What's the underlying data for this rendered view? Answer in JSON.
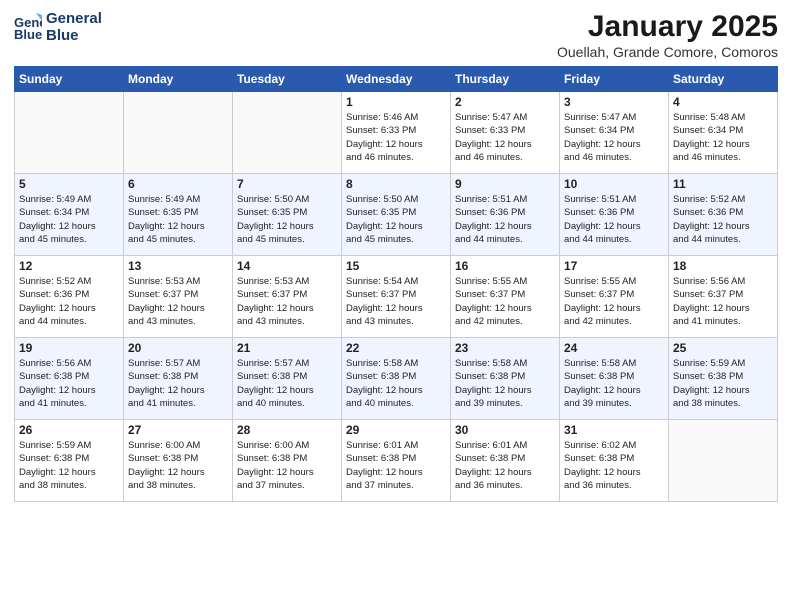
{
  "logo": {
    "line1": "General",
    "line2": "Blue"
  },
  "title": "January 2025",
  "subtitle": "Ouellah, Grande Comore, Comoros",
  "weekdays": [
    "Sunday",
    "Monday",
    "Tuesday",
    "Wednesday",
    "Thursday",
    "Friday",
    "Saturday"
  ],
  "weeks": [
    [
      {
        "day": "",
        "info": ""
      },
      {
        "day": "",
        "info": ""
      },
      {
        "day": "",
        "info": ""
      },
      {
        "day": "1",
        "info": "Sunrise: 5:46 AM\nSunset: 6:33 PM\nDaylight: 12 hours\nand 46 minutes."
      },
      {
        "day": "2",
        "info": "Sunrise: 5:47 AM\nSunset: 6:33 PM\nDaylight: 12 hours\nand 46 minutes."
      },
      {
        "day": "3",
        "info": "Sunrise: 5:47 AM\nSunset: 6:34 PM\nDaylight: 12 hours\nand 46 minutes."
      },
      {
        "day": "4",
        "info": "Sunrise: 5:48 AM\nSunset: 6:34 PM\nDaylight: 12 hours\nand 46 minutes."
      }
    ],
    [
      {
        "day": "5",
        "info": "Sunrise: 5:49 AM\nSunset: 6:34 PM\nDaylight: 12 hours\nand 45 minutes."
      },
      {
        "day": "6",
        "info": "Sunrise: 5:49 AM\nSunset: 6:35 PM\nDaylight: 12 hours\nand 45 minutes."
      },
      {
        "day": "7",
        "info": "Sunrise: 5:50 AM\nSunset: 6:35 PM\nDaylight: 12 hours\nand 45 minutes."
      },
      {
        "day": "8",
        "info": "Sunrise: 5:50 AM\nSunset: 6:35 PM\nDaylight: 12 hours\nand 45 minutes."
      },
      {
        "day": "9",
        "info": "Sunrise: 5:51 AM\nSunset: 6:36 PM\nDaylight: 12 hours\nand 44 minutes."
      },
      {
        "day": "10",
        "info": "Sunrise: 5:51 AM\nSunset: 6:36 PM\nDaylight: 12 hours\nand 44 minutes."
      },
      {
        "day": "11",
        "info": "Sunrise: 5:52 AM\nSunset: 6:36 PM\nDaylight: 12 hours\nand 44 minutes."
      }
    ],
    [
      {
        "day": "12",
        "info": "Sunrise: 5:52 AM\nSunset: 6:36 PM\nDaylight: 12 hours\nand 44 minutes."
      },
      {
        "day": "13",
        "info": "Sunrise: 5:53 AM\nSunset: 6:37 PM\nDaylight: 12 hours\nand 43 minutes."
      },
      {
        "day": "14",
        "info": "Sunrise: 5:53 AM\nSunset: 6:37 PM\nDaylight: 12 hours\nand 43 minutes."
      },
      {
        "day": "15",
        "info": "Sunrise: 5:54 AM\nSunset: 6:37 PM\nDaylight: 12 hours\nand 43 minutes."
      },
      {
        "day": "16",
        "info": "Sunrise: 5:55 AM\nSunset: 6:37 PM\nDaylight: 12 hours\nand 42 minutes."
      },
      {
        "day": "17",
        "info": "Sunrise: 5:55 AM\nSunset: 6:37 PM\nDaylight: 12 hours\nand 42 minutes."
      },
      {
        "day": "18",
        "info": "Sunrise: 5:56 AM\nSunset: 6:37 PM\nDaylight: 12 hours\nand 41 minutes."
      }
    ],
    [
      {
        "day": "19",
        "info": "Sunrise: 5:56 AM\nSunset: 6:38 PM\nDaylight: 12 hours\nand 41 minutes."
      },
      {
        "day": "20",
        "info": "Sunrise: 5:57 AM\nSunset: 6:38 PM\nDaylight: 12 hours\nand 41 minutes."
      },
      {
        "day": "21",
        "info": "Sunrise: 5:57 AM\nSunset: 6:38 PM\nDaylight: 12 hours\nand 40 minutes."
      },
      {
        "day": "22",
        "info": "Sunrise: 5:58 AM\nSunset: 6:38 PM\nDaylight: 12 hours\nand 40 minutes."
      },
      {
        "day": "23",
        "info": "Sunrise: 5:58 AM\nSunset: 6:38 PM\nDaylight: 12 hours\nand 39 minutes."
      },
      {
        "day": "24",
        "info": "Sunrise: 5:58 AM\nSunset: 6:38 PM\nDaylight: 12 hours\nand 39 minutes."
      },
      {
        "day": "25",
        "info": "Sunrise: 5:59 AM\nSunset: 6:38 PM\nDaylight: 12 hours\nand 38 minutes."
      }
    ],
    [
      {
        "day": "26",
        "info": "Sunrise: 5:59 AM\nSunset: 6:38 PM\nDaylight: 12 hours\nand 38 minutes."
      },
      {
        "day": "27",
        "info": "Sunrise: 6:00 AM\nSunset: 6:38 PM\nDaylight: 12 hours\nand 38 minutes."
      },
      {
        "day": "28",
        "info": "Sunrise: 6:00 AM\nSunset: 6:38 PM\nDaylight: 12 hours\nand 37 minutes."
      },
      {
        "day": "29",
        "info": "Sunrise: 6:01 AM\nSunset: 6:38 PM\nDaylight: 12 hours\nand 37 minutes."
      },
      {
        "day": "30",
        "info": "Sunrise: 6:01 AM\nSunset: 6:38 PM\nDaylight: 12 hours\nand 36 minutes."
      },
      {
        "day": "31",
        "info": "Sunrise: 6:02 AM\nSunset: 6:38 PM\nDaylight: 12 hours\nand 36 minutes."
      },
      {
        "day": "",
        "info": ""
      }
    ]
  ]
}
